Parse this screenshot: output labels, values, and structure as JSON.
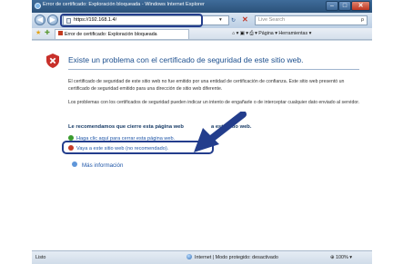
{
  "window": {
    "title": "Error de certificado: Exploración bloqueada - Windows Internet Explorer",
    "min_glyph": "–",
    "max_glyph": "□",
    "close_glyph": "✕"
  },
  "nav": {
    "back_glyph": "◀",
    "forward_glyph": "▶",
    "address": "https://192.168.1.4/",
    "address_dropdown": "▾",
    "stop_glyph": "✕",
    "search_placeholder": "Live Search",
    "search_glyph": "ρ"
  },
  "tabbar": {
    "tab_title": "Error de certificado: Exploración bloqueada",
    "tools": "⌂ ▾ ▣ ▾ ⎙ ▾ Página ▾ Herramientas ▾"
  },
  "content": {
    "heading": "Existe un problema con el certificado de seguridad de este sitio web.",
    "paragraph1": "El certificado de seguridad de este sitio web no fue emitido por una entidad de certificación de confianza. Este sitio web presentó un certificado de seguridad emitido para una dirección de sitio web diferente.",
    "paragraph2": "Los problemas con los certificados de seguridad pueden indicar un intento de engañarle o de interceptar cualquier dato enviado al servidor.",
    "recommend_prefix": "Le recomendamos que cierre esta página web",
    "recommend_suffix": "a este sitio web.",
    "option_close": "Haga clic aquí para cerrar esta página web.",
    "option_continue": "Vaya a este sitio web (no recomendado).",
    "more_info": "Más información"
  },
  "status": {
    "left": "Listo",
    "zone": "Internet | Modo protegido: desactivado",
    "zoom": "100%"
  },
  "colors": {
    "annotation": "#233d8c",
    "link": "#1f56a8",
    "heading": "#1c4f8e"
  }
}
